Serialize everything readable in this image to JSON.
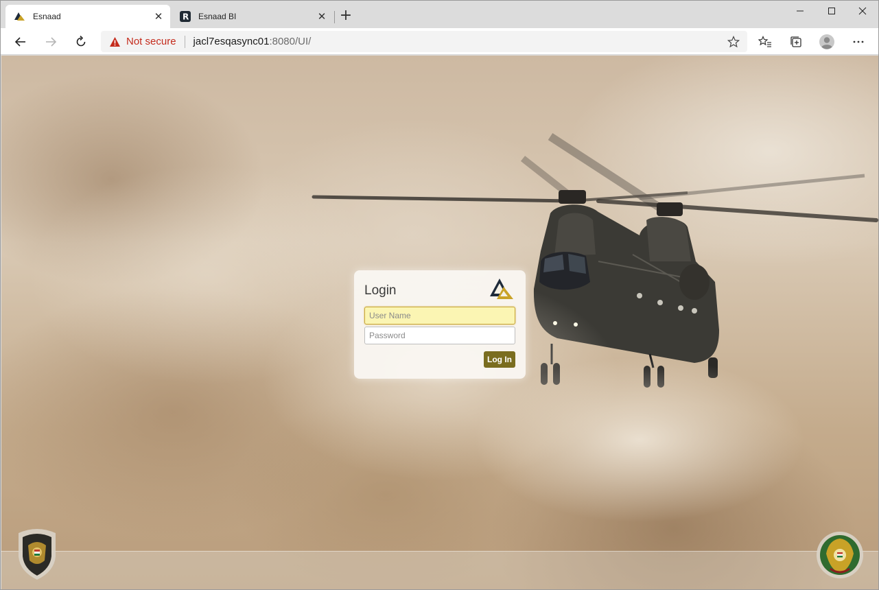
{
  "browser": {
    "tabs": [
      {
        "title": "Esnaad",
        "active": true,
        "favicon": "esnaad-logo-icon"
      },
      {
        "title": "Esnaad BI",
        "active": false,
        "favicon": "r-app-icon"
      }
    ],
    "address": {
      "security_label": "Not secure",
      "host": "jacl7esqasync01",
      "path": ":8080/UI/"
    }
  },
  "login": {
    "title": "Login",
    "username_placeholder": "User Name",
    "password_placeholder": "Password",
    "submit_label": "Log In"
  },
  "colors": {
    "accent": "#7a6d1f",
    "not_secure": "#c42b1c",
    "username_field": "#fbf5b3"
  }
}
